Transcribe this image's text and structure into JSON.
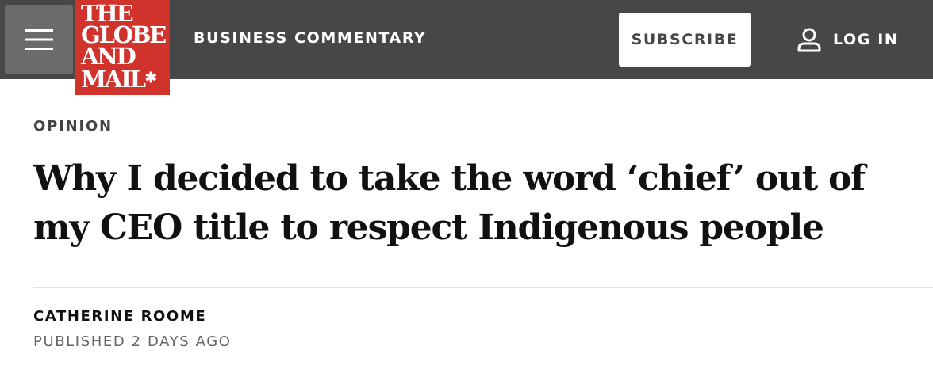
{
  "header": {
    "menu_icon": "hamburger-menu-icon",
    "logo": {
      "lines": [
        "THE",
        "GLOBE",
        "AND",
        "MAIL"
      ],
      "leaf_icon": "maple-leaf-icon",
      "leaf_glyph": "✱",
      "background": "#d0332b"
    },
    "section": "BUSINESS COMMENTARY",
    "subscribe_label": "SUBSCRIBE",
    "login_label": "LOG IN",
    "login_icon": "user-icon",
    "background": "#474747"
  },
  "article": {
    "kicker": "OPINION",
    "headline": "Why I decided to take the word ‘chief’ out of my CEO title to respect Indigenous people",
    "author": "CATHERINE ROOME",
    "published": "PUBLISHED 2 DAYS AGO"
  }
}
